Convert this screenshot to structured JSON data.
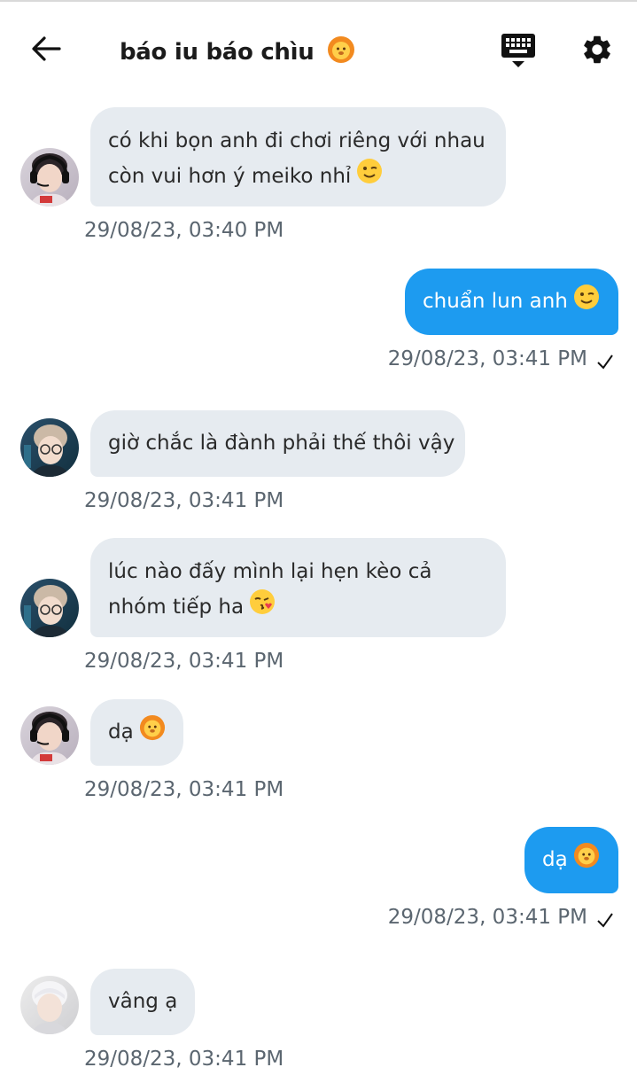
{
  "header": {
    "title": "báo iu báo chìu",
    "title_emoji": "lion-face-icon"
  },
  "colors": {
    "incoming_bubble": "#e6ebf0",
    "outgoing_bubble": "#1d9bf0",
    "timestamp": "#5b6670"
  },
  "messages": [
    {
      "direction": "in",
      "avatar": "avatar-headset",
      "lines": [
        "có khi bọn anh đi chơi riêng với nhau",
        "còn vui hơn ý meiko nhỉ"
      ],
      "emoji": "wink-face-icon",
      "time": "29/08/23, 03:40 PM"
    },
    {
      "direction": "out",
      "lines": [
        "chuẩn lun anh"
      ],
      "emoji": "wink-face-icon",
      "time": "29/08/23, 03:41 PM"
    },
    {
      "direction": "in",
      "avatar": "avatar-glasses",
      "lines": [
        "giờ chắc là đành phải thế thôi vậy"
      ],
      "time": "29/08/23, 03:41 PM"
    },
    {
      "direction": "in",
      "avatar": "avatar-glasses",
      "lines": [
        "lúc nào đấy mình lại hẹn kèo cả",
        "nhóm tiếp ha"
      ],
      "emoji": "kiss-face-icon",
      "time": "29/08/23, 03:41 PM"
    },
    {
      "direction": "in",
      "avatar": "avatar-headset",
      "lines": [
        "dạ"
      ],
      "emoji": "lion-face-icon",
      "time": "29/08/23, 03:41 PM"
    },
    {
      "direction": "out",
      "lines": [
        "dạ"
      ],
      "emoji": "lion-face-icon",
      "time": "29/08/23, 03:41 PM"
    },
    {
      "direction": "in",
      "avatar": "avatar-white-hair",
      "lines": [
        "vâng ạ"
      ],
      "time": "29/08/23, 03:41 PM"
    }
  ]
}
